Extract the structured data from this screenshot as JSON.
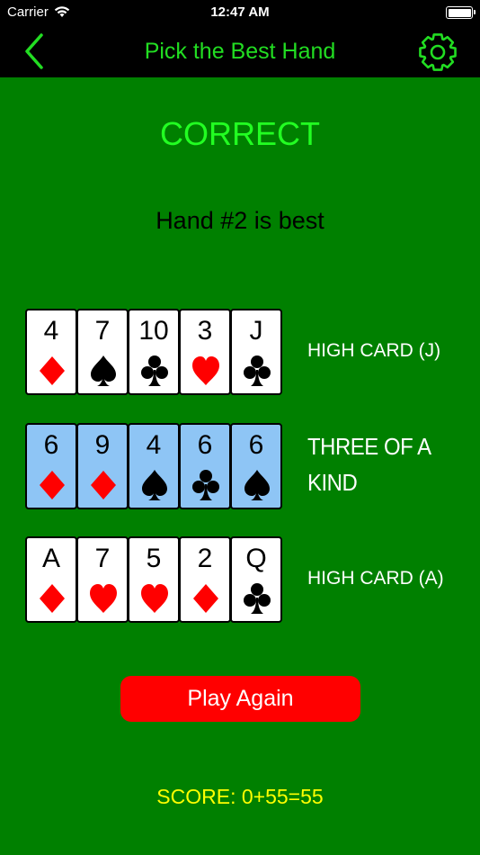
{
  "status": {
    "carrier": "Carrier",
    "time": "12:47 AM"
  },
  "nav": {
    "title": "Pick the Best Hand",
    "back_icon": "chevron-left-icon",
    "settings_icon": "gear-icon"
  },
  "result": "CORRECT",
  "verdict": "Hand #2 is best",
  "colors": {
    "red": "#ff0000",
    "black": "#000000",
    "felt": "#008000",
    "accent": "#22dd22",
    "score": "#ffff00",
    "selected": "#8ec5f5"
  },
  "hands": [
    {
      "label": "HIGH CARD (J)",
      "selected": false,
      "cards": [
        {
          "rank": "4",
          "suit": "diamond"
        },
        {
          "rank": "7",
          "suit": "spade"
        },
        {
          "rank": "10",
          "suit": "club"
        },
        {
          "rank": "3",
          "suit": "heart"
        },
        {
          "rank": "J",
          "suit": "club"
        }
      ]
    },
    {
      "label": "THREE OF A KIND",
      "selected": true,
      "cards": [
        {
          "rank": "6",
          "suit": "diamond"
        },
        {
          "rank": "9",
          "suit": "diamond"
        },
        {
          "rank": "4",
          "suit": "spade"
        },
        {
          "rank": "6",
          "suit": "club"
        },
        {
          "rank": "6",
          "suit": "spade"
        }
      ]
    },
    {
      "label": "HIGH CARD (A)",
      "selected": false,
      "cards": [
        {
          "rank": "A",
          "suit": "diamond"
        },
        {
          "rank": "7",
          "suit": "heart"
        },
        {
          "rank": "5",
          "suit": "heart"
        },
        {
          "rank": "2",
          "suit": "diamond"
        },
        {
          "rank": "Q",
          "suit": "club"
        }
      ]
    }
  ],
  "play_again": "Play Again",
  "score": "SCORE: 0+55=55"
}
